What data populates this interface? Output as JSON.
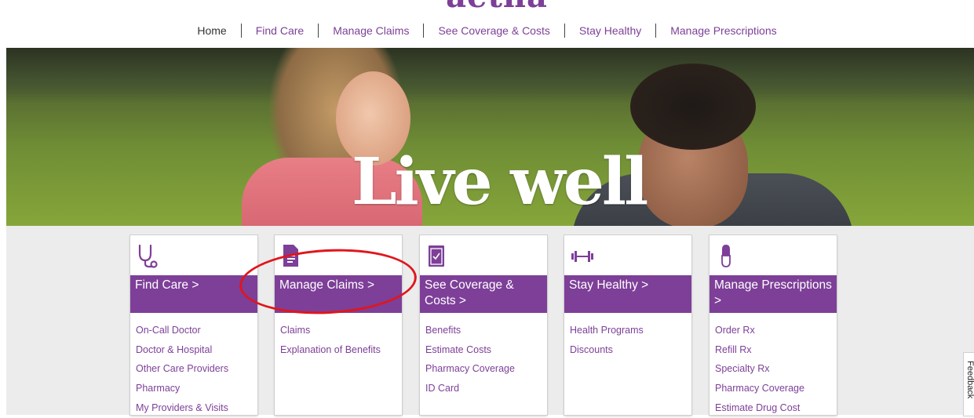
{
  "logo": {
    "text": "aetna"
  },
  "topnav": {
    "items": [
      {
        "label": "Home"
      },
      {
        "label": "Find Care"
      },
      {
        "label": "Manage Claims"
      },
      {
        "label": "See Coverage & Costs"
      },
      {
        "label": "Stay Healthy"
      },
      {
        "label": "Manage Prescriptions"
      }
    ]
  },
  "hero": {
    "headline": "Live well"
  },
  "cards": [
    {
      "title": "Find Care >",
      "icon": "stethoscope-icon",
      "links": [
        "On-Call Doctor",
        "Doctor & Hospital",
        "Other Care Providers",
        "Pharmacy",
        "My Providers & Visits"
      ]
    },
    {
      "title": "Manage Claims >",
      "icon": "document-icon",
      "links": [
        "Claims",
        "Explanation of Benefits"
      ]
    },
    {
      "title": "See Coverage & Costs >",
      "icon": "clipboard-check-icon",
      "links": [
        "Benefits",
        "Estimate Costs",
        "Pharmacy Coverage",
        "ID Card"
      ]
    },
    {
      "title": "Stay Healthy >",
      "icon": "dumbbell-icon",
      "links": [
        "Health Programs",
        "Discounts"
      ]
    },
    {
      "title": "Manage Prescriptions >",
      "icon": "pill-capsule-icon",
      "links": [
        "Order Rx",
        "Refill Rx",
        "Specialty Rx",
        "Pharmacy Coverage",
        "Estimate Drug Cost"
      ]
    }
  ],
  "feedback": {
    "label": "Feedback"
  },
  "colors": {
    "brand": "#7d3f98",
    "annotation": "#e0161c",
    "background": "#ececec"
  }
}
